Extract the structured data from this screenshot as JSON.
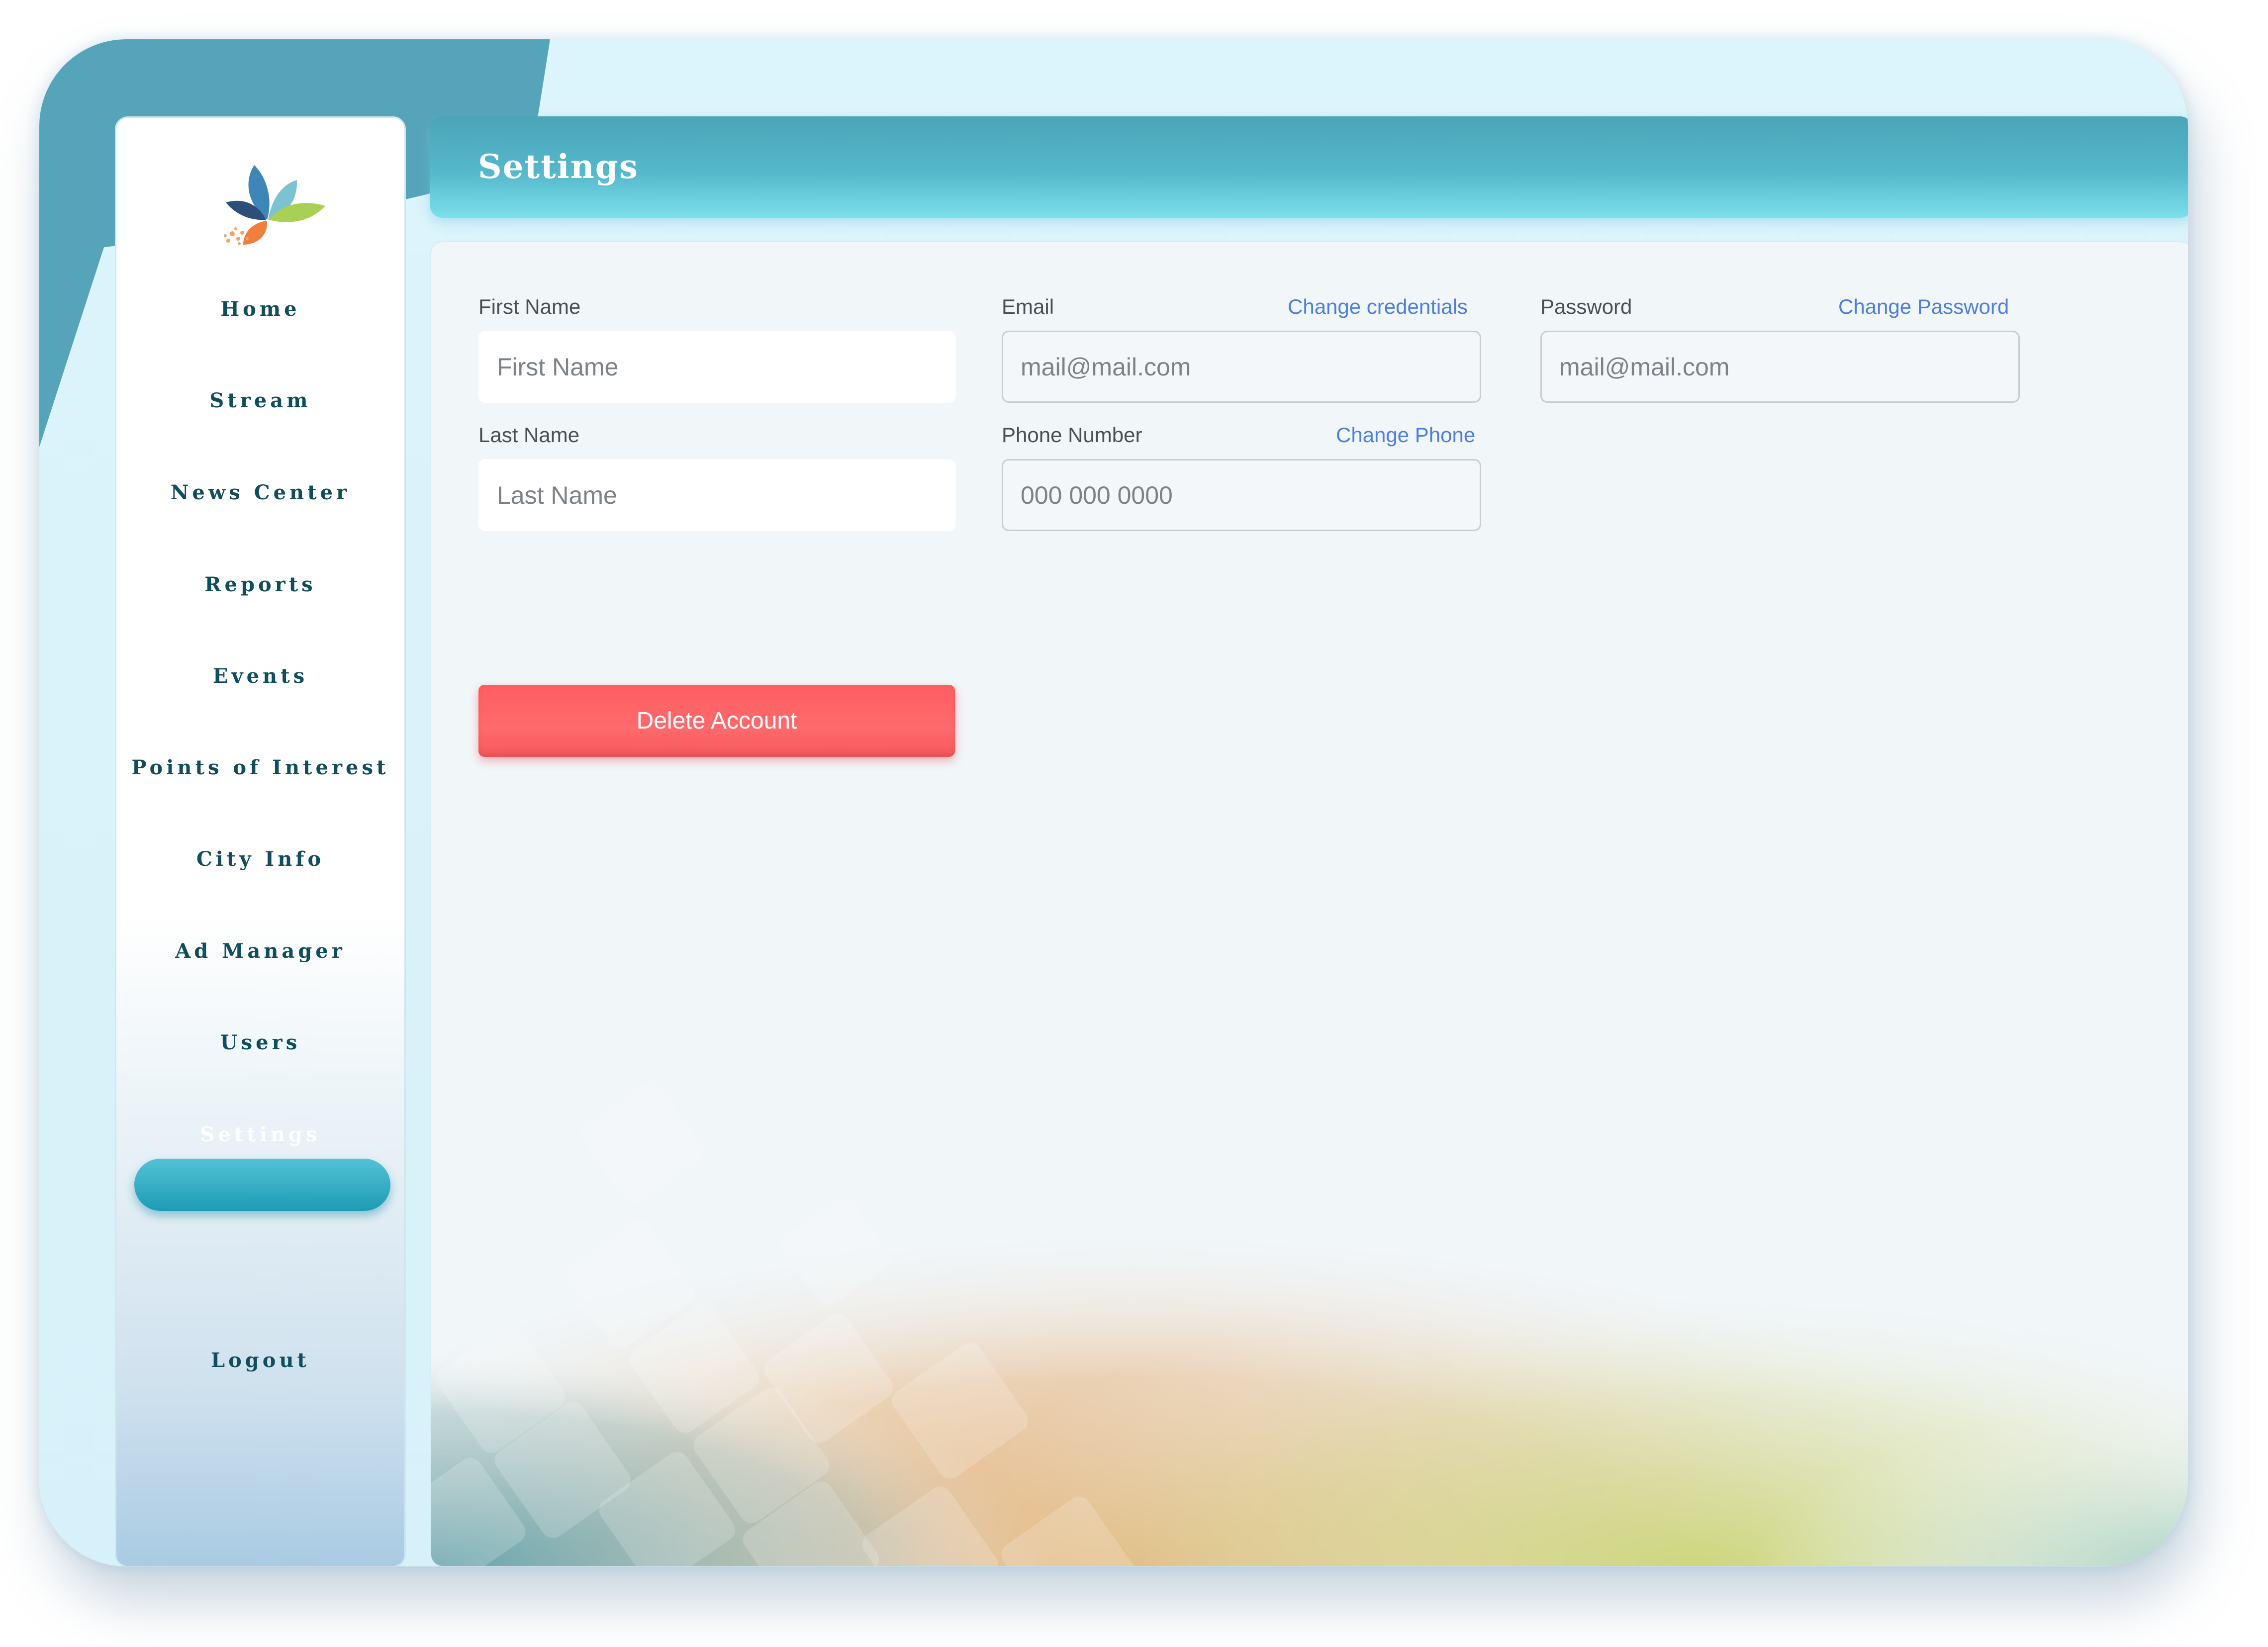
{
  "sidebar": {
    "logo": "lotus-leaf-logo",
    "items": [
      {
        "label": "Home"
      },
      {
        "label": "Stream"
      },
      {
        "label": "News Center"
      },
      {
        "label": "Reports"
      },
      {
        "label": "Events"
      },
      {
        "label": "Points of Interest"
      },
      {
        "label": "City Info"
      },
      {
        "label": "Ad Manager"
      },
      {
        "label": "Users"
      },
      {
        "label": "Settings",
        "active": true
      }
    ],
    "logout_label": "Logout"
  },
  "header": {
    "title": "Settings"
  },
  "form": {
    "first_name": {
      "label": "First Name",
      "placeholder": "First Name"
    },
    "last_name": {
      "label": "Last Name",
      "placeholder": "Last Name"
    },
    "email": {
      "label": "Email",
      "link": "Change credentials",
      "value": "mail@mail.com"
    },
    "phone": {
      "label": "Phone Number",
      "link": "Change Phone",
      "value": "000 000 0000"
    },
    "password": {
      "label": "Password",
      "link": "Change Password",
      "value": "mail@mail.com"
    },
    "delete_label": "Delete Account"
  },
  "colors": {
    "accent": "#1e9bb4",
    "nav_text": "#114e5c",
    "link": "#4f7ee0",
    "danger": "#ff5e61"
  }
}
